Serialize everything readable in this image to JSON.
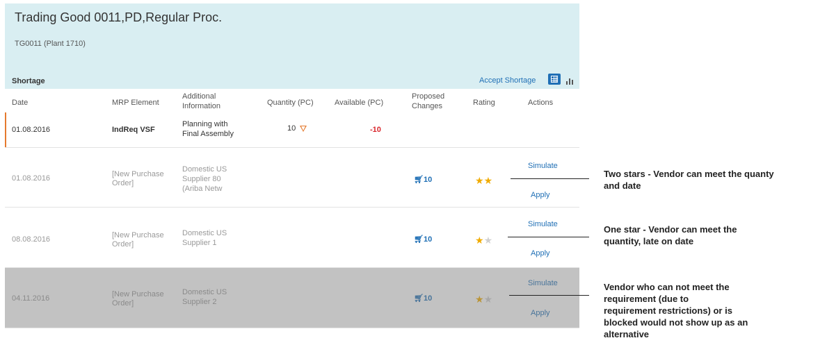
{
  "header": {
    "title": "Trading Good 0011,PD,Regular Proc.",
    "subtitle": "TG0011 (Plant 1710)"
  },
  "toolbar": {
    "section_title": "Shortage",
    "accept_label": "Accept Shortage",
    "grid_icon": "table-view-icon",
    "chart_icon": "chart-view-icon"
  },
  "columns": {
    "date": "Date",
    "mrp": "MRP Element",
    "info_1": "Additional",
    "info_2": "Information",
    "qty": "Quantity (PC)",
    "available": "Available (PC)",
    "proposed_1": "Proposed",
    "proposed_2": "Changes",
    "rating": "Rating",
    "actions": "Actions"
  },
  "rows": [
    {
      "date": "01.08.2016",
      "mrp": "IndReq VSF",
      "info_1": "Planning with",
      "info_2": "Final Assembly",
      "qty": "10",
      "available": "-10"
    },
    {
      "date": "01.08.2016",
      "mrp_1": "[New Purchase",
      "mrp_2": "Order]",
      "info_1": "Domestic US",
      "info_2": "Supplier 80",
      "info_3": "(Ariba Netw",
      "proposed": "10",
      "stars": 2,
      "simulate": "Simulate",
      "apply": "Apply"
    },
    {
      "date": "08.08.2016",
      "mrp_1": "[New Purchase",
      "mrp_2": "Order]",
      "info_1": "Domestic US",
      "info_2": "Supplier 1",
      "proposed": "10",
      "stars": 1,
      "simulate": "Simulate",
      "apply": "Apply"
    },
    {
      "date": "04.11.2016",
      "mrp_1": "[New Purchase",
      "mrp_2": "Order]",
      "info_1": "Domestic US",
      "info_2": "Supplier 2",
      "proposed": "10",
      "stars": 1,
      "simulate": "Simulate",
      "apply": "Apply"
    }
  ],
  "annotations": {
    "a1_l1": "Two stars - Vendor can meet the quanty",
    "a1_l2": "and date",
    "a2_l1": "One star - Vendor can meet the",
    "a2_l2": "quantity, late on date",
    "a3_l1": "Vendor who can not meet the",
    "a3_l2": "requirement (due to",
    "a3_l3": "requirement restrictions) or is",
    "a3_l4": "blocked would not show up as an",
    "a3_l5": "alternative"
  },
  "colors": {
    "header_bg": "#d9eef2",
    "link": "#1f6fb5",
    "star": "#f0ab00",
    "negative": "#d9262c",
    "warning": "#e57a2e"
  }
}
